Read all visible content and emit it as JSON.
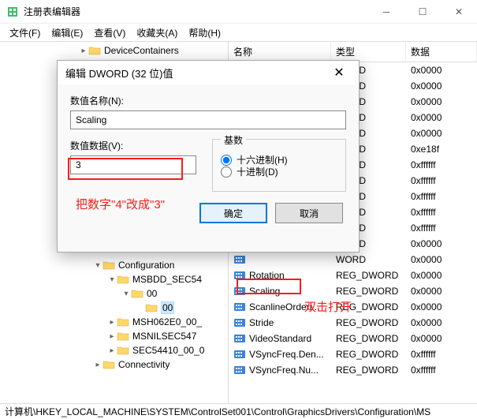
{
  "window": {
    "title": "注册表编辑器"
  },
  "menu": {
    "file": "文件(F)",
    "edit": "编辑(E)",
    "view": "查看(V)",
    "favorites": "收藏夹(A)",
    "help": "帮助(H)"
  },
  "tree": {
    "top": "DeviceContainers",
    "configuration": "Configuration",
    "msbdd": "MSBDD_SEC54",
    "n00a": "00",
    "n00b": "00",
    "msh": "MSH062E0_00_",
    "msnil": "MSNILSEC547",
    "sec": "SEC54410_00_0",
    "conn": "Connectivity"
  },
  "list": {
    "header_name": "名称",
    "header_type": "类型",
    "header_data": "数据",
    "rows": [
      {
        "name": "",
        "type": "WORD",
        "data": "0x0000"
      },
      {
        "name": "",
        "type": "WORD",
        "data": "0x0000"
      },
      {
        "name": "",
        "type": "WORD",
        "data": "0x0000"
      },
      {
        "name": "",
        "type": "WORD",
        "data": "0x0000"
      },
      {
        "name": "",
        "type": "WORD",
        "data": "0x0000"
      },
      {
        "name": "",
        "type": "WORD",
        "data": "0xe18f"
      },
      {
        "name": "",
        "type": "WORD",
        "data": "0xffffff"
      },
      {
        "name": "",
        "type": "WORD",
        "data": "0xffffff"
      },
      {
        "name": "",
        "type": "WORD",
        "data": "0xffffff"
      },
      {
        "name": "",
        "type": "WORD",
        "data": "0xffffff"
      },
      {
        "name": "",
        "type": "WORD",
        "data": "0xffffff"
      },
      {
        "name": "",
        "type": "WORD",
        "data": "0x0000"
      },
      {
        "name": "",
        "type": "WORD",
        "data": "0x0000"
      },
      {
        "name": "Rotation",
        "type": "REG_DWORD",
        "data": "0x0000"
      },
      {
        "name": "Scaling",
        "type": "REG_DWORD",
        "data": "0x0000"
      },
      {
        "name": "ScanlineOrderi...",
        "type": "REG_DWORD",
        "data": "0x0000"
      },
      {
        "name": "Stride",
        "type": "REG_DWORD",
        "data": "0x0000"
      },
      {
        "name": "VideoStandard",
        "type": "REG_DWORD",
        "data": "0x0000"
      },
      {
        "name": "VSyncFreq.Den...",
        "type": "REG_DWORD",
        "data": "0xffffff"
      },
      {
        "name": "VSyncFreq.Nu...",
        "type": "REG_DWORD",
        "data": "0xffffff"
      }
    ]
  },
  "dialog": {
    "title": "编辑 DWORD (32 位)值",
    "name_label": "数值名称(N):",
    "name_value": "Scaling",
    "data_label": "数值数据(V):",
    "data_value": "3",
    "base_legend": "基数",
    "radio_hex": "十六进制(H)",
    "radio_dec": "十进制(D)",
    "ok": "确定",
    "cancel": "取消"
  },
  "annotations": {
    "change_text": "把数字\"4\"改成\"3\"",
    "dblclick_text": "双击打开"
  },
  "statusbar": {
    "path": "计算机\\HKEY_LOCAL_MACHINE\\SYSTEM\\ControlSet001\\Control\\GraphicsDrivers\\Configuration\\MS"
  }
}
